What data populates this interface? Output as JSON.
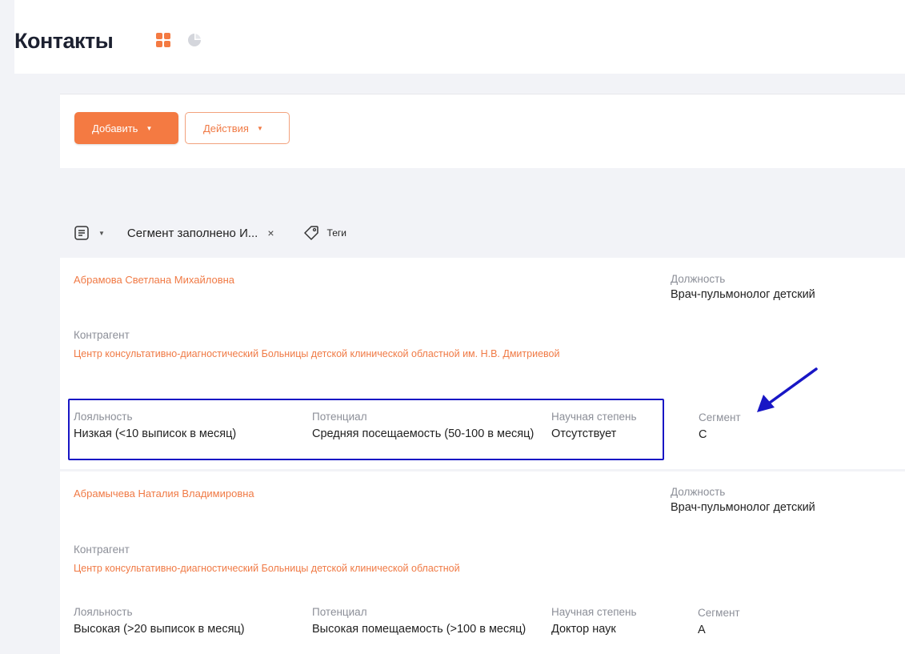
{
  "header": {
    "title": "Контакты",
    "icons": [
      "grid-icon",
      "pie-chart-icon"
    ],
    "accent": "#f47a42"
  },
  "toolbar": {
    "add_label": "Добавить",
    "actions_label": "Действия"
  },
  "filters": {
    "chip_label": "Сегмент заполнено И...",
    "chip_close": "×",
    "tags_label": "Теги"
  },
  "labels": {
    "position": "Должность",
    "counterparty": "Контрагент",
    "loyalty": "Лояльность",
    "potential": "Потенциал",
    "degree": "Научная степень",
    "segment": "Сегмент"
  },
  "contacts": [
    {
      "name": "Абрамова Светлана Михайловна",
      "position": "Врач-пульмонолог детский",
      "counterparty": "Центр консультативно-диагностический Больницы детской клинической областной им. Н.В. Дмитриевой",
      "loyalty": "Низкая (<10 выписок в месяц)",
      "potential": "Средняя посещаемость (50-100 в месяц)",
      "degree": "Отсутствует",
      "segment": "C"
    },
    {
      "name": "Абрамычева Наталия Владимировна",
      "position": "Врач-пульмонолог детский",
      "counterparty": "Центр консультативно-диагностический Больницы детской клинической областной",
      "loyalty": "Высокая (>20 выписок в месяц)",
      "potential": "Высокая помещаемость (>100 в месяц)",
      "degree": "Доктор наук",
      "segment": "A"
    }
  ],
  "colors": {
    "brand": "#f47a42",
    "highlight": "#1816c5",
    "link": "#f07a45"
  }
}
